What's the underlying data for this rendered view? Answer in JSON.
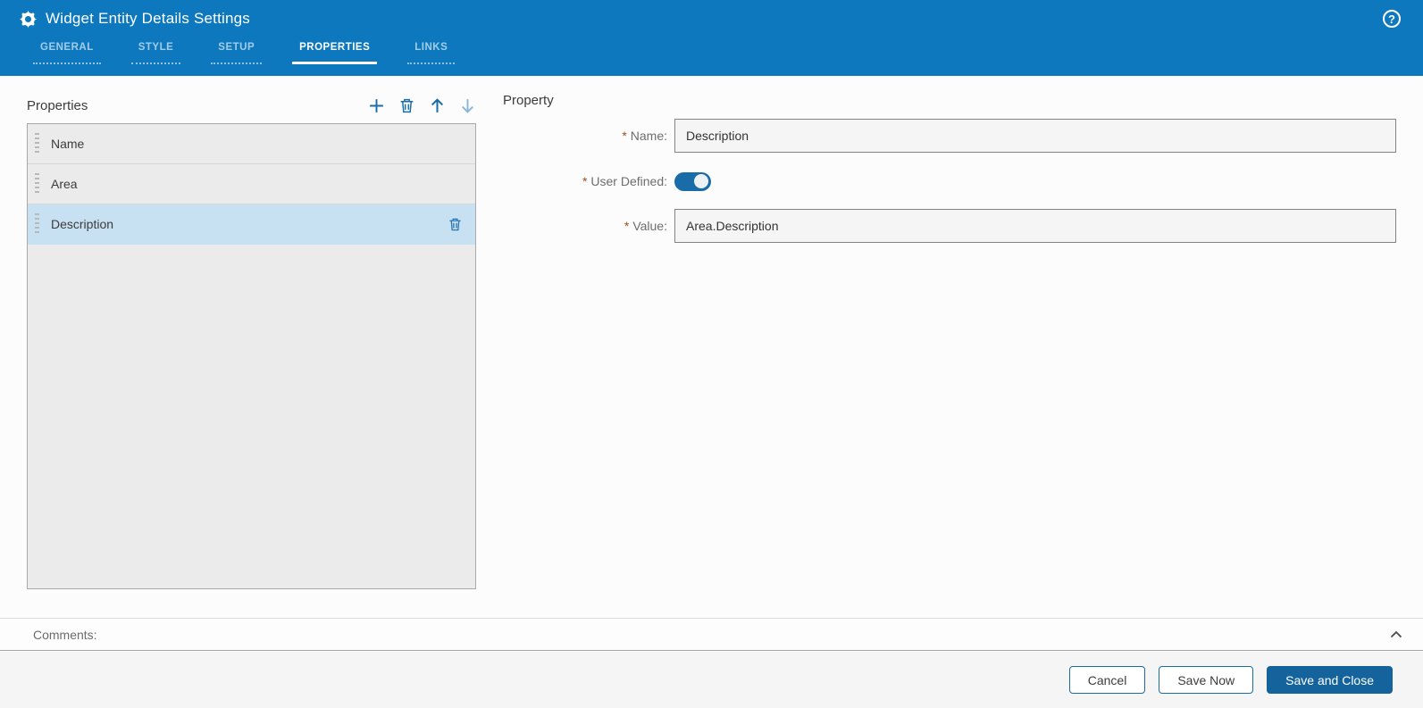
{
  "colors": {
    "header_blue": "#0d78be",
    "accent_blue": "#1a6ca8",
    "disabled_icon_blue": "#8cb8d8",
    "selected_row_blue": "#c8e1f2",
    "primary_button_blue": "#14639c",
    "required_marker_color": "#9c4f1e"
  },
  "header": {
    "title": "Widget Entity Details Settings",
    "gear_icon": "gear-icon",
    "help_icon": "help-circle-icon",
    "tabs": [
      {
        "label": "GENERAL",
        "active": false
      },
      {
        "label": "STYLE",
        "active": false
      },
      {
        "label": "SETUP",
        "active": false
      },
      {
        "label": "PROPERTIES",
        "active": true
      },
      {
        "label": "LINKS",
        "active": false
      }
    ]
  },
  "left_panel": {
    "title": "Properties",
    "toolbar": {
      "add_icon": "plus-icon",
      "delete_icon": "trash-icon",
      "move_up_icon": "arrow-up-icon",
      "move_down_icon": "arrow-down-icon",
      "move_down_disabled": true
    },
    "items": [
      {
        "label": "Name",
        "selected": false
      },
      {
        "label": "Area",
        "selected": false
      },
      {
        "label": "Description",
        "selected": true
      }
    ]
  },
  "right_panel": {
    "title": "Property",
    "required_marker": "*",
    "fields": {
      "name": {
        "label": "Name:",
        "required": true,
        "value": "Description"
      },
      "user_defined": {
        "label": "User Defined:",
        "required": true,
        "state": "on"
      },
      "value": {
        "label": "Value:",
        "required": true,
        "value": "Area.Description"
      }
    }
  },
  "comments": {
    "label": "Comments:",
    "collapse_icon": "chevron-up-icon"
  },
  "footer": {
    "cancel_label": "Cancel",
    "save_now_label": "Save Now",
    "save_and_close_label": "Save and Close"
  }
}
